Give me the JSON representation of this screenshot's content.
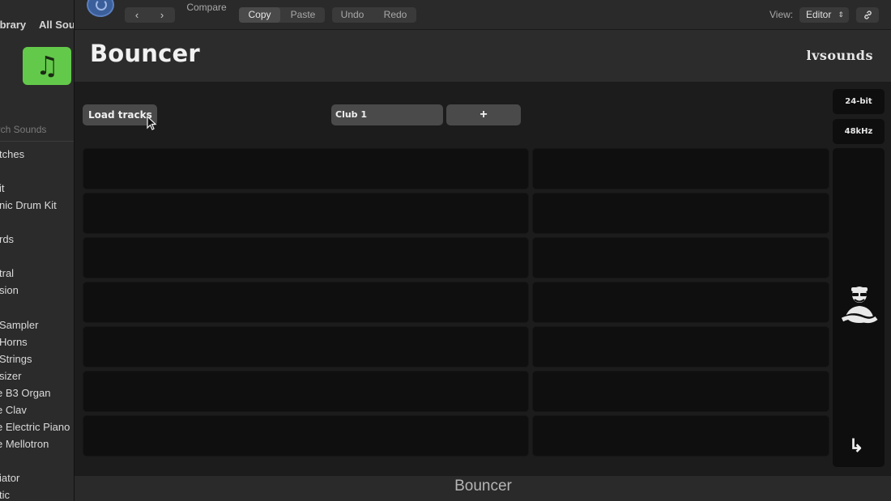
{
  "library": {
    "tabs": [
      "ibrary",
      "All Soun"
    ],
    "search_placeholder": "arch Sounds",
    "items": [
      "tches",
      "it",
      "nic Drum Kit",
      "rds",
      "tral",
      "sion",
      "Sampler",
      "Horns",
      "Strings",
      "sizer",
      "e B3 Organ",
      "e Clav",
      "e Electric Piano",
      "e Mellotron",
      "iator",
      "tic"
    ]
  },
  "toolbar": {
    "back_arrow": "‹",
    "forward_arrow": "›",
    "compare_label": "Compare",
    "copy_label": "Copy",
    "paste_label": "Paste",
    "undo_label": "Undo",
    "redo_label": "Redo",
    "view_label": "View:",
    "view_value": "Editor",
    "link_icon": "link-icon"
  },
  "header": {
    "title": "Bouncer",
    "logo_text": "lvsounds"
  },
  "main": {
    "load_tracks_label": "Load tracks",
    "preset_label": "Club 1",
    "add_label": "+",
    "bit_depth": "24-bit",
    "sample_rate": "48kHz",
    "export_icon": "↳"
  },
  "footer": {
    "title": "Bouncer"
  },
  "colors": {
    "accent_power": "#3b5f9a",
    "library_tile": "#63c94a",
    "cell_bg": "#0f0f0f"
  }
}
